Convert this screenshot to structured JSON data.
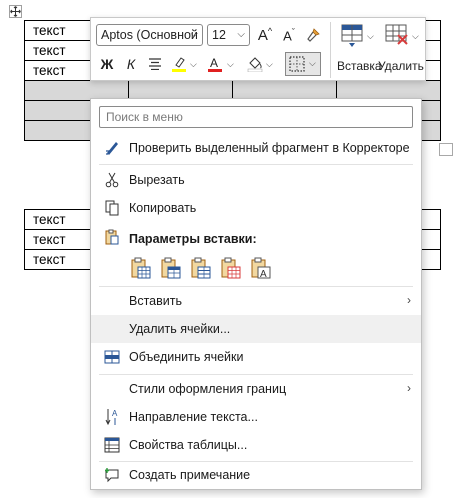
{
  "document": {
    "table1_rows": [
      {
        "c1": "текст",
        "selected": false
      },
      {
        "c1": "текст",
        "selected": false
      },
      {
        "c1": "текст",
        "selected": false
      },
      {
        "c1": "",
        "selected": true
      },
      {
        "c1": "",
        "selected": true
      },
      {
        "c1": "",
        "selected": true
      }
    ],
    "table2_rows": [
      {
        "c1": "текст"
      },
      {
        "c1": "текст"
      },
      {
        "c1": "текст"
      }
    ]
  },
  "mini_toolbar": {
    "font_name": "Aptos (Основной",
    "font_size": "12",
    "increase_font_glyph": "A",
    "decrease_font_glyph": "A",
    "bold_glyph": "Ж",
    "italic_glyph": "К",
    "insert_label": "Вставка",
    "delete_label": "Удалить",
    "highlight_color": "#ffff00",
    "font_color": "#e02020"
  },
  "context_menu": {
    "search_placeholder": "Поиск в меню",
    "items": [
      {
        "label": "Проверить выделенный фрагмент в Корректоре",
        "icon": "proofing-pen-icon"
      },
      {
        "label": "Вырезать",
        "icon": "scissors-icon"
      },
      {
        "label": "Копировать",
        "icon": "copy-icon"
      },
      {
        "label": "Параметры вставки:",
        "icon": "paste-clipboard-icon"
      },
      {
        "label": "Вставить",
        "icon": "",
        "submenu": "›"
      },
      {
        "label": "Удалить ячейки...",
        "icon": ""
      },
      {
        "label": "Объединить ячейки",
        "icon": "merge-cells-icon"
      },
      {
        "label": "Стили оформления границ",
        "icon": "",
        "submenu": "›"
      },
      {
        "label": "Направление текста...",
        "icon": "text-direction-icon"
      },
      {
        "label": "Свойства таблицы...",
        "icon": "table-properties-icon"
      },
      {
        "label": "Создать примечание",
        "icon": "new-comment-icon"
      }
    ],
    "paste_options": [
      "paste-nest-table-icon",
      "paste-merge-table-icon",
      "paste-insert-rows-icon",
      "paste-overwrite-cells-icon",
      "paste-text-only-icon"
    ]
  },
  "colors": {
    "accent": "#2b5797",
    "selection": "#d8d8d8"
  }
}
